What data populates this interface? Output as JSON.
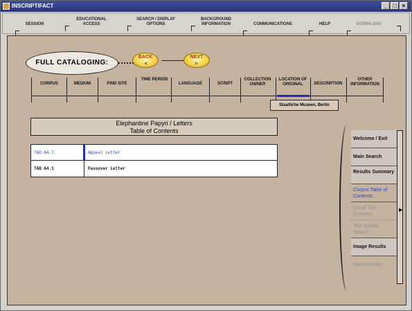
{
  "window": {
    "title": "INSCRIPTIFACT"
  },
  "menu": [
    {
      "label": "SESSION",
      "disabled": false
    },
    {
      "label": "EDUCATIONAL ACCESS",
      "disabled": false
    },
    {
      "label": "SEARCH / DISPLAY OPTIONS",
      "disabled": false
    },
    {
      "label": "BACKGROUND INFORMATION",
      "disabled": false
    },
    {
      "label": "COMMUNICATIONS",
      "disabled": false
    },
    {
      "label": "HELP",
      "disabled": false
    },
    {
      "label": "DOWNLOAD",
      "disabled": true
    }
  ],
  "mode": {
    "label": "FULL CATALOGING:"
  },
  "nav": {
    "back": "BACK",
    "next": "NEXT"
  },
  "tabs": [
    "CORPUS",
    "MEDIUM",
    "FIND SITE",
    "TIME PERIOD",
    "LANGUAGE",
    "SCRIPT",
    "COLLECTION OWNER",
    "LOCATION OF ORIGINAL",
    "DESCRIPTION",
    "OTHER INFORMATION"
  ],
  "active_tab_value": "Staatliche Museen, Berlin",
  "toc": {
    "title": "Elephantine Papyri / Letters",
    "subtitle": "Table of Contents",
    "rows": [
      {
        "code": "TAD A4.7",
        "name": "Appeal Letter",
        "selected": true
      },
      {
        "code": "TAD A4.1",
        "name": "Passover Letter",
        "selected": false
      }
    ]
  },
  "side_nav": [
    {
      "label": "Welcome / Exit",
      "state": "normal"
    },
    {
      "label": "Main Search",
      "state": "normal"
    },
    {
      "label": "Results Summary",
      "state": "normal"
    },
    {
      "label": "Corpus Table of Contents",
      "state": "current"
    },
    {
      "label": "List of Text Divisions",
      "state": "disabled"
    },
    {
      "label": "Text Spatial Search",
      "state": "disabled"
    },
    {
      "label": "Image Results",
      "state": "normal"
    },
    {
      "label": "View/Desktop",
      "state": "disabled"
    }
  ],
  "colors": {
    "accent": "#1a2fbf",
    "panel": "#c5b3a0",
    "titlebar": "#2a3478"
  }
}
